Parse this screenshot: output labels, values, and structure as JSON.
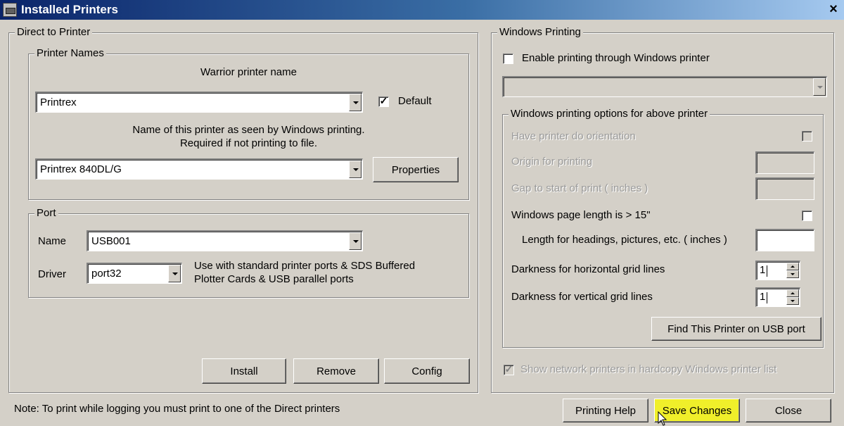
{
  "window": {
    "title": "Installed Printers",
    "close_glyph": "×"
  },
  "direct": {
    "legend": "Direct to Printer",
    "names": {
      "legend": "Printer Names",
      "warrior_label": "Warrior printer name",
      "warrior_value": "Printrex",
      "default_label": "Default",
      "default_checked": "✓",
      "windows_name_line1": "Name of this printer as seen by Windows printing.",
      "windows_name_line2": "Required if not printing to file.",
      "windows_value": "Printrex 840DL/G",
      "properties_label": "Properties"
    },
    "port": {
      "legend": "Port",
      "name_label": "Name",
      "name_value": "USB001",
      "driver_label": "Driver",
      "driver_value": "port32",
      "driver_note_line1": "Use with standard printer ports & SDS Buffered",
      "driver_note_line2": "Plotter Cards & USB parallel ports"
    },
    "buttons": {
      "install": "Install",
      "remove": "Remove",
      "config": "Config"
    }
  },
  "windows": {
    "legend": "Windows Printing",
    "enable_label": "Enable printing through Windows printer",
    "options": {
      "legend": "Windows printing options for above printer",
      "orientation_label": "Have printer do orientation",
      "origin_label": "Origin for printing",
      "gap_label": "Gap to start of print ( inches )",
      "page_length_label": "Windows page length is > 15\"",
      "heading_length_label": "Length for headings, pictures, etc. ( inches )",
      "horiz_grid_label": "Darkness for horizontal grid lines",
      "horiz_grid_value": "1",
      "vert_grid_label": "Darkness for vertical grid lines",
      "vert_grid_value": "1",
      "find_usb_label": "Find This Printer on USB port"
    },
    "network_label": "Show network printers in hardcopy Windows printer list",
    "network_checked": "✓"
  },
  "footer": {
    "note": "Note:  To print while logging you must print to one of the Direct printers",
    "help_label": "Printing Help",
    "save_label": "Save Changes",
    "close_label": "Close"
  },
  "colors": {
    "title_start": "#0a246a",
    "title_end": "#a6caf0",
    "face": "#d4d0c8",
    "highlight": "#f0ef2a"
  }
}
